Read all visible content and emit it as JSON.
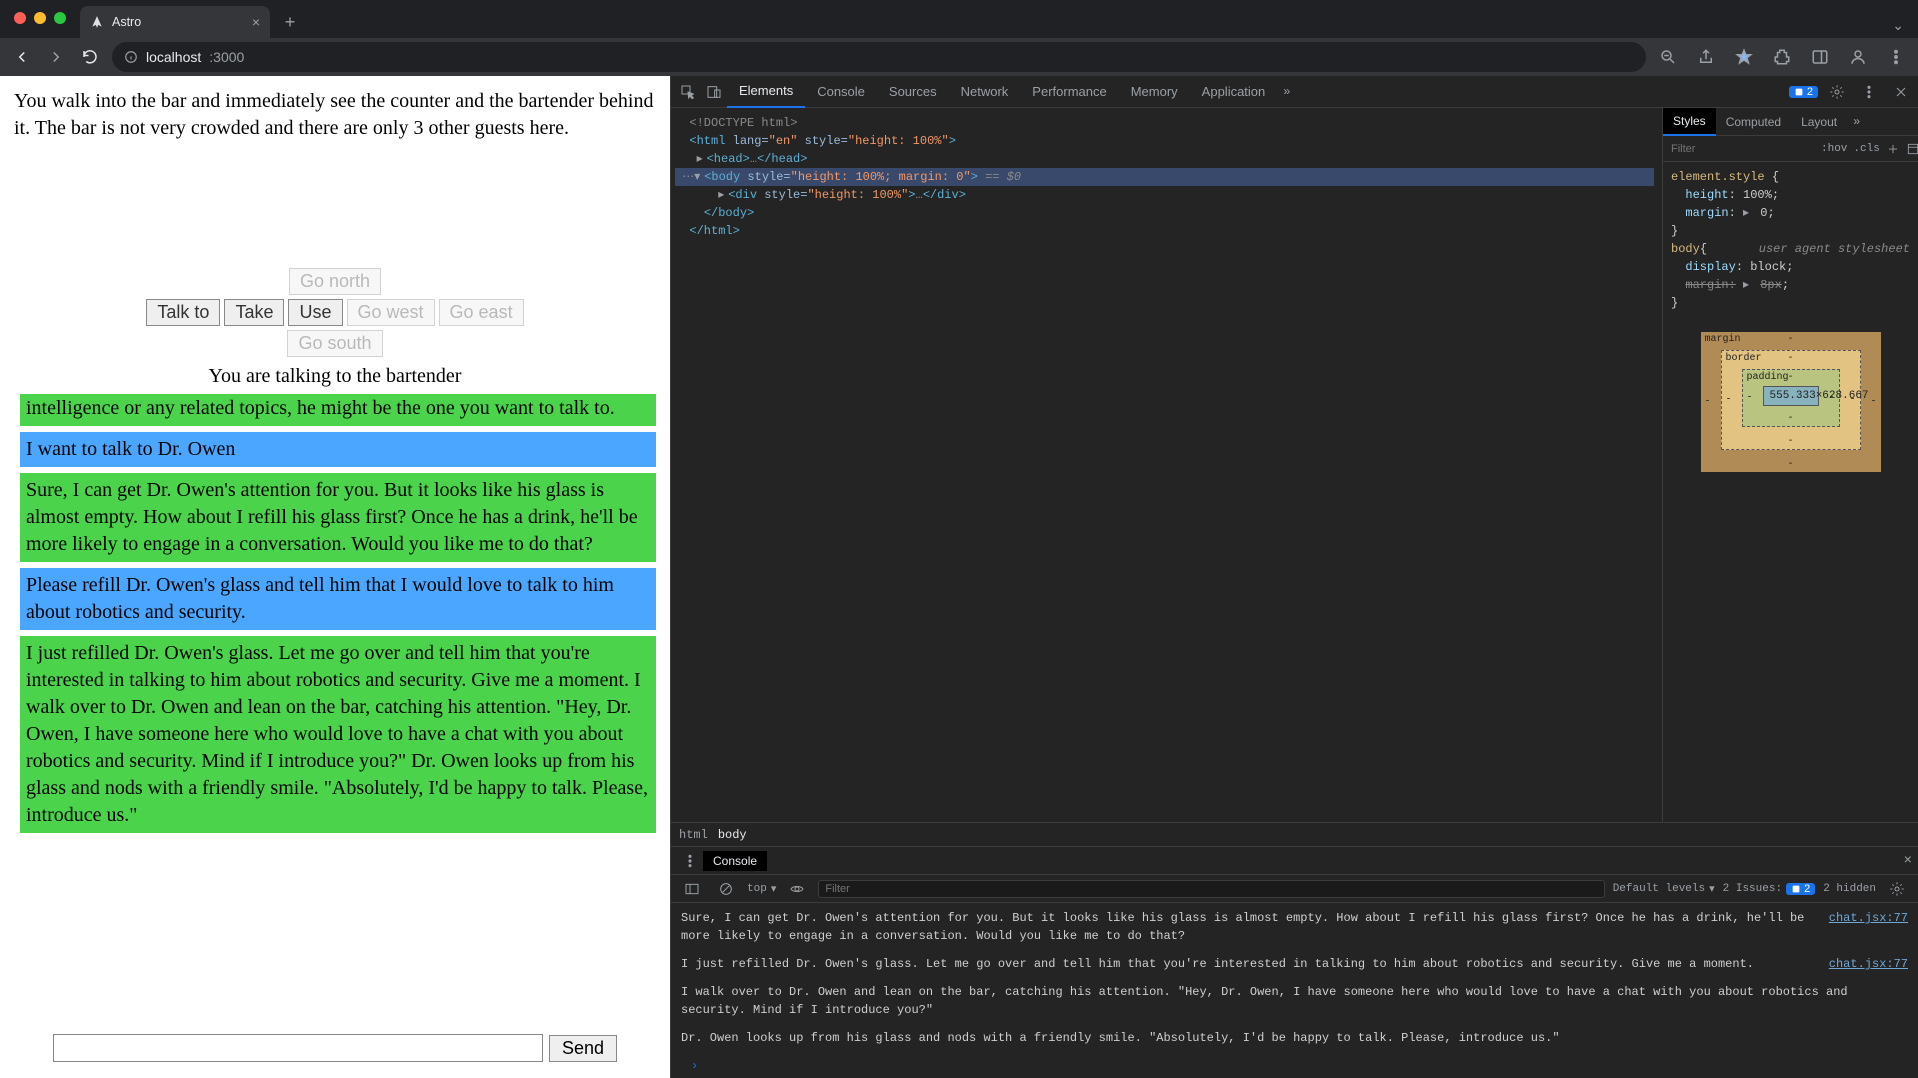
{
  "browser": {
    "tab_title": "Astro",
    "url_host": "localhost",
    "url_port": ":3000"
  },
  "game": {
    "narration": "You walk into the bar and immediately see the counter and the bartender behind it. The bar is not very crowded and there are only 3 other guests here.",
    "buttons": {
      "talk_to": "Talk to",
      "take": "Take",
      "use": "Use",
      "north": "Go north",
      "west": "Go west",
      "east": "Go east",
      "south": "Go south"
    },
    "talking_to": "You are talking to the bartender",
    "messages": [
      {
        "role": "npc",
        "text": "robotics. If you're interested in discussing advancements in artificial intelligence or any related topics, he might be the one you want to talk to."
      },
      {
        "role": "user",
        "text": "I want to talk to Dr. Owen"
      },
      {
        "role": "npc",
        "text": "Sure, I can get Dr. Owen's attention for you. But it looks like his glass is almost empty. How about I refill his glass first? Once he has a drink, he'll be more likely to engage in a conversation. Would you like me to do that?"
      },
      {
        "role": "user",
        "text": "Please refill Dr. Owen's glass and tell him that I would love to talk to him about robotics and security."
      },
      {
        "role": "npc",
        "text": "I just refilled Dr. Owen's glass. Let me go over and tell him that you're interested in talking to him about robotics and security. Give me a moment. I walk over to Dr. Owen and lean on the bar, catching his attention. \"Hey, Dr. Owen, I have someone here who would love to have a chat with you about robotics and security. Mind if I introduce you?\" Dr. Owen looks up from his glass and nods with a friendly smile. \"Absolutely, I'd be happy to talk. Please, introduce us.\""
      }
    ],
    "send_label": "Send",
    "input_value": ""
  },
  "devtools": {
    "tabs": [
      "Elements",
      "Console",
      "Sources",
      "Network",
      "Performance",
      "Memory",
      "Application"
    ],
    "active_tab": "Elements",
    "issues_count": "2",
    "dom": {
      "l0": "<!DOCTYPE html>",
      "l1a": "<html ",
      "l1_attr": "lang=",
      "l1_val": "\"en\"",
      "l1b": " style=",
      "l1_val2": "\"height: 100%\"",
      "l1c": ">",
      "l2": "<head>",
      "l2b": "…",
      "l2c": "</head>",
      "l3a": "<body ",
      "l3_attr": "style=",
      "l3_val": "\"height: 100%; margin: 0\"",
      "l3b": ">",
      "eq0": " == $0",
      "l4a": "<div ",
      "l4_attr": "style=",
      "l4_val": "\"height: 100%\"",
      "l4b": ">",
      "l4c": "…",
      "l4d": "</div>",
      "l5": "</body>",
      "l6": "</html>"
    },
    "breadcrumb": [
      "html",
      "body"
    ],
    "styles_tabs": [
      "Styles",
      "Computed",
      "Layout"
    ],
    "styles_filter_placeholder": "Filter",
    "hov_label": ":hov",
    "cls_label": ".cls",
    "rules": {
      "es_sel": "element.style",
      "es_p1": "height",
      "es_v1": "100%",
      "es_p2": "margin",
      "es_v2": "0",
      "body_sel": "body",
      "uas": "user agent stylesheet",
      "b_p1": "display",
      "b_v1": "block",
      "b_p2": "margin",
      "b_v2": "8px"
    },
    "box": {
      "margin": "margin",
      "border": "border",
      "padding": "padding",
      "dim": "555.333×628.667"
    },
    "console": {
      "tab": "Console",
      "ctx": "top",
      "filter_placeholder": "Filter",
      "levels": "Default levels",
      "issues_label": "2 Issues:",
      "issues_badge": "2",
      "hidden": "2 hidden",
      "entries": [
        {
          "text": "Sure, I can get Dr. Owen's attention for you. But it looks like his glass is almost empty. How about I refill his glass first? Once he has a drink, he'll be more likely to engage in a conversation. Would you like me to do that?",
          "src": "chat.jsx:77"
        },
        {
          "text": "I just refilled Dr. Owen's glass. Let me go over and tell him that you're interested in talking to him about robotics and security. Give me a moment.",
          "src": "chat.jsx:77"
        },
        {
          "text": "I walk over to Dr. Owen and lean on the bar, catching his attention. \"Hey, Dr. Owen, I have someone here who would love to have a chat with you about robotics and security. Mind if I introduce you?\"",
          "src": ""
        },
        {
          "text": "Dr. Owen looks up from his glass and nods with a friendly smile. \"Absolutely, I'd be happy to talk. Please, introduce us.\"",
          "src": ""
        }
      ]
    }
  }
}
